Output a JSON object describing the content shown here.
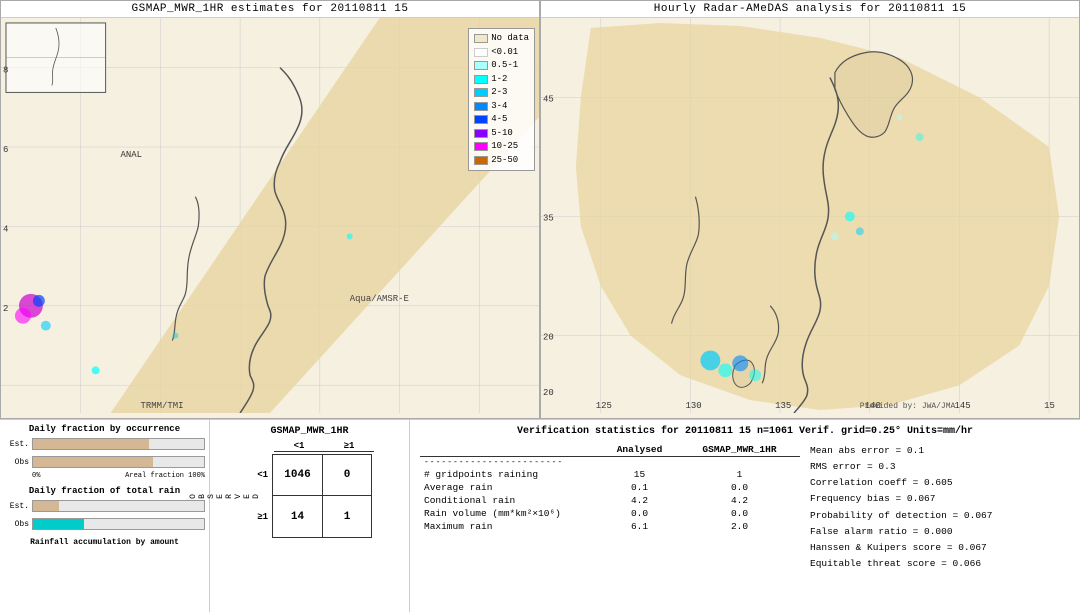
{
  "left_map": {
    "title": "GSMAP_MWR_1HR estimates for 20110811 15",
    "labels": {
      "anal": "ANAL",
      "trmm": "TRMM/TMI",
      "aqua": "Aqua/AMSR-E"
    },
    "y_labels": [
      "8",
      "6",
      "4",
      "2"
    ],
    "legend": {
      "title": "",
      "items": [
        {
          "label": "No data",
          "color": "#f0e8c8"
        },
        {
          "label": "<0.01",
          "color": "#ffffff"
        },
        {
          "label": "0.5-1",
          "color": "#00ffff"
        },
        {
          "label": "1-2",
          "color": "#00ccff"
        },
        {
          "label": "2-3",
          "color": "#0088ff"
        },
        {
          "label": "3-4",
          "color": "#0044ff"
        },
        {
          "label": "4-5",
          "color": "#0000cc"
        },
        {
          "label": "5-10",
          "color": "#aa00ff"
        },
        {
          "label": "10-25",
          "color": "#ff00ff"
        },
        {
          "label": "25-50",
          "color": "#cc6600"
        }
      ]
    }
  },
  "right_map": {
    "title": "Hourly Radar-AMeDAS analysis for 20110811 15",
    "credit": "Provided by: JWA/JMA",
    "lat_labels": [
      "45",
      "35",
      "20"
    ],
    "lon_labels": [
      "125",
      "130",
      "135",
      "140",
      "145",
      "15"
    ]
  },
  "bottom_left": {
    "chart1_title": "Daily fraction by occurrence",
    "chart2_title": "Daily fraction of total rain",
    "chart3_title": "Rainfall accumulation by amount",
    "est_label": "Est.",
    "obs_label": "Obs",
    "axis_0": "0%",
    "axis_100": "Areal fraction 100%",
    "est_bar1_pct": 68,
    "obs_bar1_pct": 70,
    "est_bar2_pct": 15,
    "obs_bar2_pct": 30
  },
  "confusion": {
    "title": "GSMAP_MWR_1HR",
    "col_labels": [
      "<1",
      "≥1"
    ],
    "row_labels": [
      "<1",
      "≥1"
    ],
    "obs_label": "O B S E R V E D",
    "values": {
      "tl": "1046",
      "tr": "0",
      "bl": "14",
      "br": "1"
    }
  },
  "verification": {
    "title": "Verification statistics for 20110811 15  n=1061  Verif. grid=0.25°  Units=mm/hr",
    "col_headers": [
      "",
      "Analysed",
      "GSMAP_MWR_1HR"
    ],
    "separator": "------------------------",
    "rows": [
      {
        "label": "# gridpoints raining",
        "analysed": "15",
        "gsmap": "1"
      },
      {
        "label": "Average rain",
        "analysed": "0.1",
        "gsmap": "0.0"
      },
      {
        "label": "Conditional rain",
        "analysed": "4.2",
        "gsmap": "4.2"
      },
      {
        "label": "Rain volume (mm*km²×10⁶)",
        "analysed": "0.0",
        "gsmap": "0.0"
      },
      {
        "label": "Maximum rain",
        "analysed": "6.1",
        "gsmap": "2.0"
      }
    ],
    "right_stats": [
      "Mean abs error = 0.1",
      "RMS error = 0.3",
      "Correlation coeff = 0.605",
      "Frequency bias = 0.067",
      "Probability of detection = 0.067",
      "False alarm ratio = 0.000",
      "Hanssen & Kuipers score = 0.067",
      "Equitable threat score = 0.066"
    ]
  }
}
